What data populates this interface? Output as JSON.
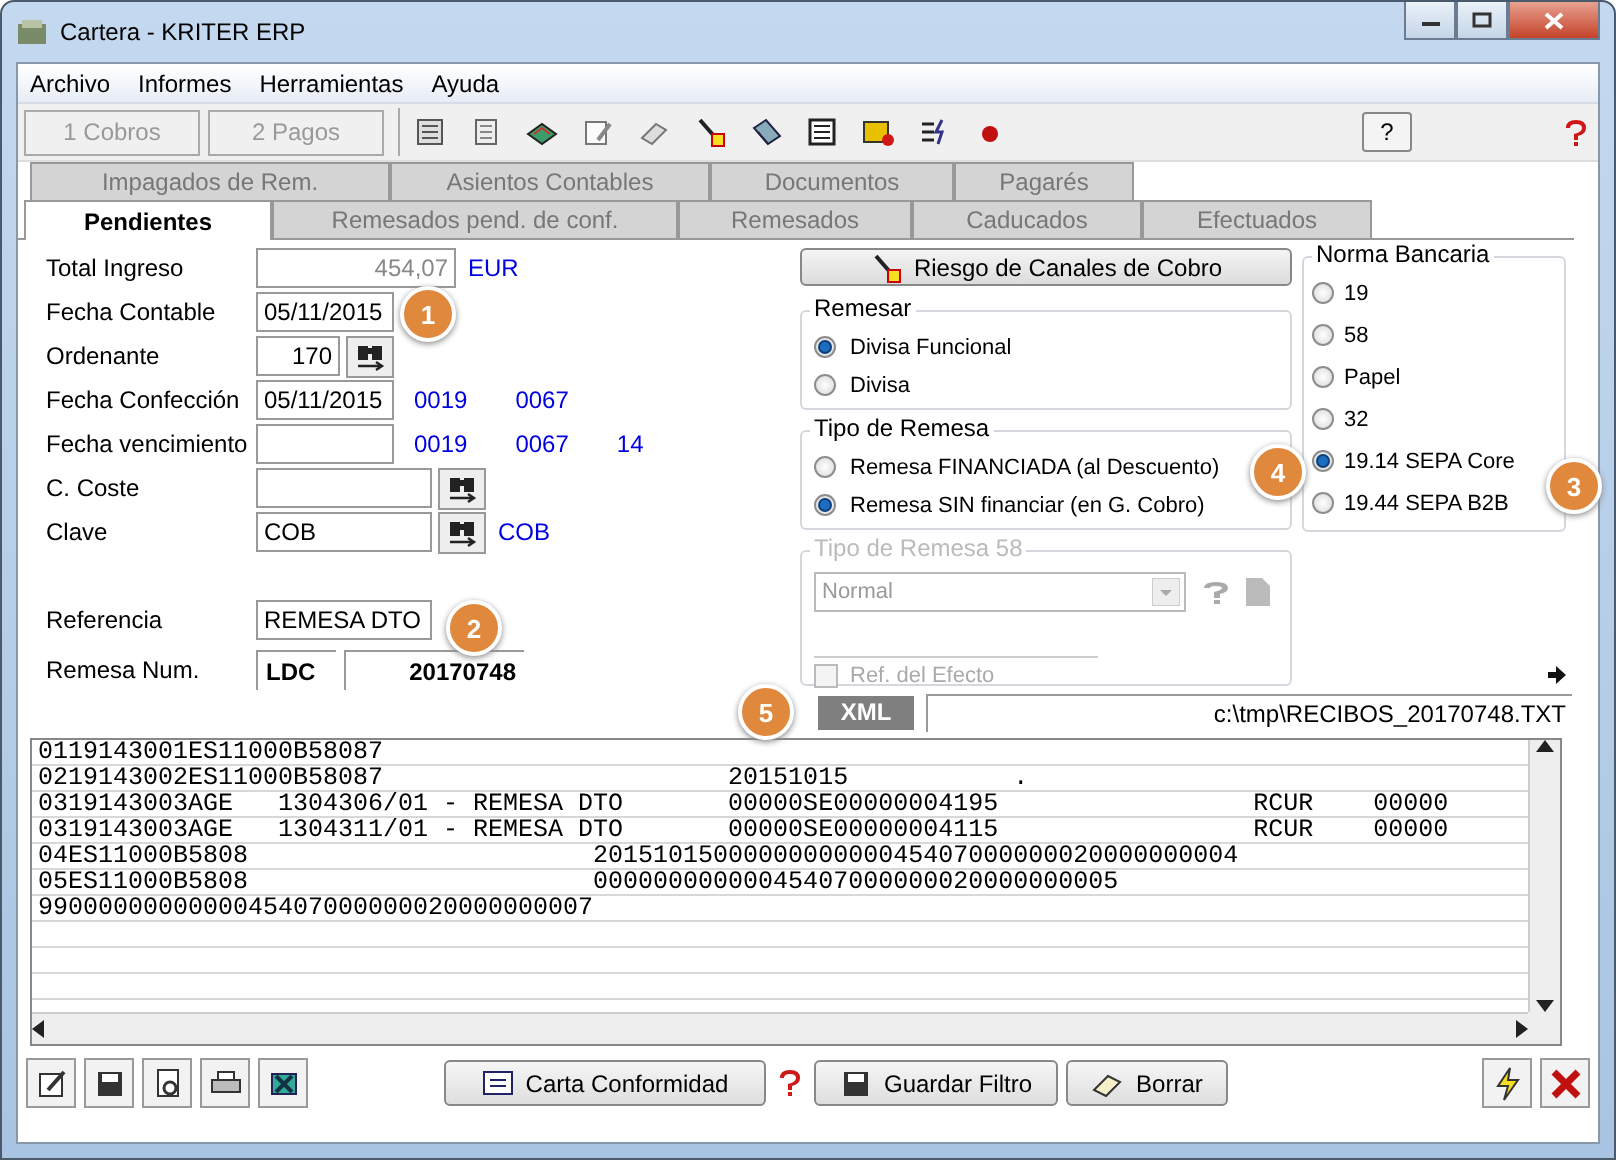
{
  "window": {
    "title": "Cartera - KRITER ERP"
  },
  "menu": [
    {
      "label": "Archivo"
    },
    {
      "label": "Informes"
    },
    {
      "label": "Herramientas"
    },
    {
      "label": "Ayuda"
    }
  ],
  "toolbar": {
    "buttons": [
      {
        "label": "1 Cobros",
        "disabled": true
      },
      {
        "label": "2 Pagos",
        "disabled": true
      }
    ],
    "help": "?"
  },
  "tabs_back": [
    {
      "label": "Impagados de Rem.",
      "selected": false
    },
    {
      "label": "Asientos Contables",
      "selected": false
    },
    {
      "label": "Documentos",
      "selected": false
    },
    {
      "label": "Pagarés",
      "selected": false
    }
  ],
  "tabs_front": [
    {
      "label": "Pendientes",
      "selected": true
    },
    {
      "label": "Remesados pend. de conf.",
      "selected": false
    },
    {
      "label": "Remesados",
      "selected": false
    },
    {
      "label": "Caducados",
      "selected": false
    },
    {
      "label": "Efectuados",
      "selected": false
    }
  ],
  "fields": [
    {
      "label": "Total Ingreso",
      "kind": "amount",
      "value": "454,07",
      "extras": [
        "EUR"
      ]
    },
    {
      "label": "Fecha Contable",
      "kind": "date",
      "value": "05/11/2015"
    },
    {
      "label": "Ordenante",
      "kind": "number",
      "value": "170",
      "lookup": true
    },
    {
      "label": "Fecha Confección",
      "kind": "date",
      "value": "05/11/2015",
      "extras": [
        "0019",
        "0067"
      ]
    },
    {
      "label": "Fecha vencimiento",
      "kind": "date",
      "extras": [
        "0019",
        "0067",
        "14"
      ]
    },
    {
      "label": "C. Coste",
      "kind": "code",
      "lookup": true
    },
    {
      "label": "Clave",
      "kind": "code",
      "value": "COB",
      "lookup": true,
      "extras": [
        "COB"
      ]
    },
    {
      "label": "Referencia",
      "kind": "code",
      "value": "REMESA DTO"
    }
  ],
  "remesa_num": {
    "label": "Remesa Num.",
    "series": "LDC",
    "number": "20170748"
  },
  "risk_button": "Riesgo de Canales de Cobro",
  "remesar": {
    "title": "Remesar",
    "options": [
      {
        "label": "Divisa Funcional",
        "selected": true
      },
      {
        "label": "Divisa",
        "selected": false
      }
    ]
  },
  "tipo_remesa": {
    "title": "Tipo de Remesa",
    "options": [
      {
        "label": "Remesa FINANCIADA (al Descuento)",
        "selected": false
      },
      {
        "label": "Remesa SIN financiar  (en G. Cobro)",
        "selected": true
      }
    ]
  },
  "tipo_remesa_58": {
    "title": "Tipo de Remesa 58",
    "disabled": true,
    "select": "Normal",
    "checkbox": {
      "label": "Ref. del Efecto",
      "checked": false
    }
  },
  "norma_bancaria": {
    "title": "Norma Bancaria",
    "options": [
      {
        "label": "19",
        "selected": false
      },
      {
        "label": "58",
        "selected": false
      },
      {
        "label": "Papel",
        "selected": false
      },
      {
        "label": "32",
        "selected": false
      },
      {
        "label": "19.14 SEPA Core",
        "selected": true
      },
      {
        "label": "19.44 SEPA B2B",
        "selected": false
      }
    ]
  },
  "xml": {
    "button": "XML",
    "path": "c:\\tmp\\RECIBOS_20170748.TXT"
  },
  "output_lines": [
    "0119143001ES11000B58087",
    "0219143002ES11000B58087                       20151015           .",
    "0319143003AGE   1304306/01 - REMESA DTO       00000SE00000004195                 RCUR    00000",
    "0319143003AGE   1304311/01 - REMESA DTO       00000SE00000004115                 RCUR    00000",
    "04ES11000B5808                       2015101500000000000045407000000020000000004",
    "05ES11000B5808                       00000000000045407000000020000000005",
    "9900000000000045407000000020000000007"
  ],
  "bottom_buttons": [
    {
      "label": "Carta Conformidad"
    },
    {
      "label": "Guardar Filtro"
    },
    {
      "label": "Borrar"
    }
  ],
  "callouts": [
    "1",
    "2",
    "3",
    "4",
    "5"
  ]
}
